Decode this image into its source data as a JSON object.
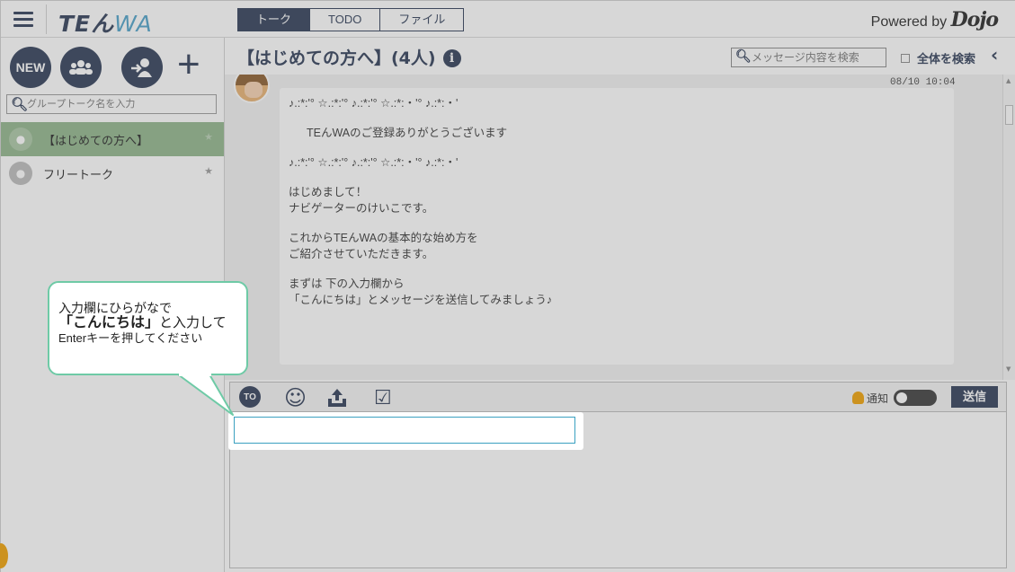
{
  "app": {
    "logo_main": "TE",
    "logo_n": "ん",
    "logo_wa": "WA",
    "powered_prefix": "Powered by",
    "powered_brand": "Dojo"
  },
  "tabs": [
    {
      "label": "トーク"
    },
    {
      "label": "TODO"
    },
    {
      "label": "ファイル"
    }
  ],
  "sidebar": {
    "new_label": "NEW",
    "search_placeholder": "グループトーク名を入力",
    "rooms": [
      {
        "label": "【はじめての方へ】"
      },
      {
        "label": "フリートーク"
      }
    ]
  },
  "room": {
    "title": "【はじめての方へ】(4人)",
    "search_placeholder": "メッセージ内容を検索",
    "all_search_label": "全体を検索"
  },
  "message": {
    "timestamp": "08/10 10:04",
    "line1": "♪.:*:'° ☆.:*:'° ♪.:*:'° ☆.:*:・'° ♪.:*:・'",
    "line2": "TEんWAのご登録ありがとうございます",
    "line3": "♪.:*:'° ☆.:*:'° ♪.:*:'° ☆.:*:・'° ♪.:*:・'",
    "line4": "はじめまして！\nナビゲーターのけいこです。",
    "line5": "これからTEんWAの基本的な始め方を\nご紹介させていただきます。",
    "line6": "まずは 下の入力欄から\n「こんにちは」とメッセージを送信してみましょう♪"
  },
  "composer": {
    "to_label": "TO",
    "notify_label": "通知",
    "send_label": "送信",
    "input_value": ""
  },
  "tutorial": {
    "line1": "入力欄にひらがなで",
    "line2_bold": "「こんにちは」",
    "line2_rest": "と入力して",
    "line3": "Enterキーを押してください"
  },
  "colors": {
    "brand_navy": "#2b3a55",
    "active_room": "#8fb58a",
    "callout_border": "#6ecaa6",
    "notify_bell": "#f0a000"
  }
}
